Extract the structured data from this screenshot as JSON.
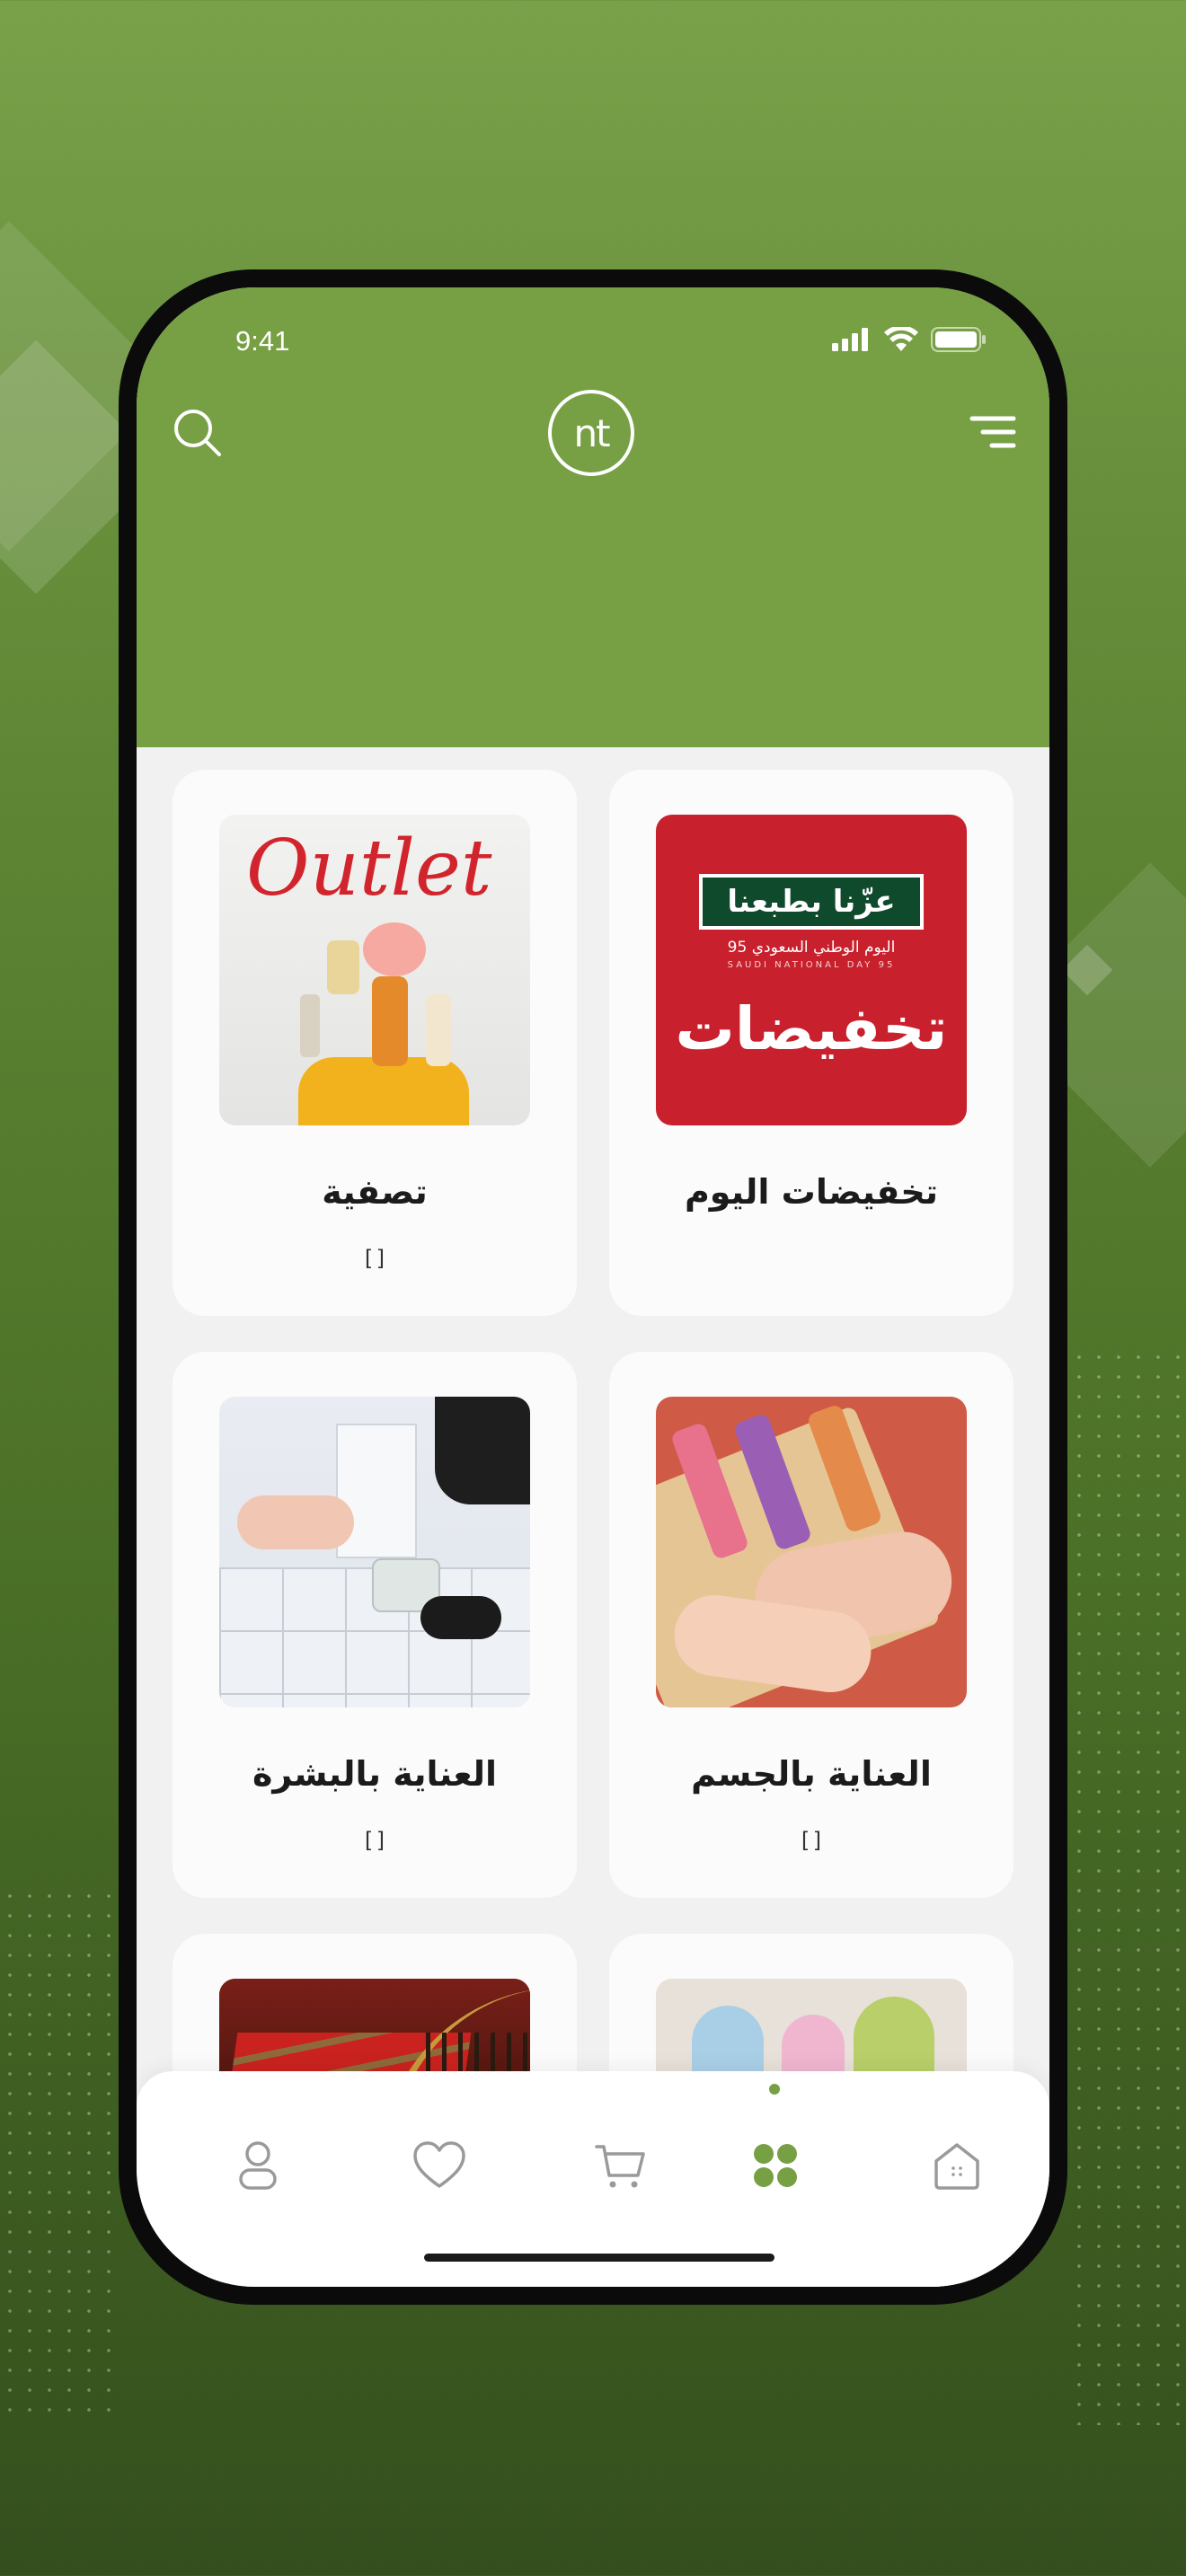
{
  "status_bar": {
    "time": "9:41"
  },
  "header": {
    "logo_text": "nt",
    "search_icon": "search-icon",
    "menu_icon": "menu-icon"
  },
  "colors": {
    "brand_green": "#76a043",
    "card_bg": "#fbfbfb",
    "screen_bg": "#f1f1f1"
  },
  "categories": [
    {
      "title": "تخفيضات اليوم",
      "count": "",
      "image_title": "تخفيضات",
      "image_banner": "عزّنا بطبعنا",
      "image_sub": "اليوم الوطني السعودي 95",
      "image_sub2": "SAUDI NATIONAL DAY 95"
    },
    {
      "title": "تصفية",
      "count": "[]",
      "image_title": "Outlet"
    },
    {
      "title": "العناية بالجسم",
      "count": "[]"
    },
    {
      "title": "العناية بالبشرة",
      "count": "[]"
    },
    {
      "title": "",
      "count": ""
    },
    {
      "title": "",
      "count": ""
    }
  ],
  "bottom_nav": [
    {
      "name": "home",
      "icon": "home-icon",
      "active": false
    },
    {
      "name": "categories",
      "icon": "grid-icon",
      "active": true
    },
    {
      "name": "cart",
      "icon": "cart-icon",
      "active": false
    },
    {
      "name": "favorites",
      "icon": "heart-icon",
      "active": false
    },
    {
      "name": "profile",
      "icon": "user-icon",
      "active": false
    }
  ]
}
